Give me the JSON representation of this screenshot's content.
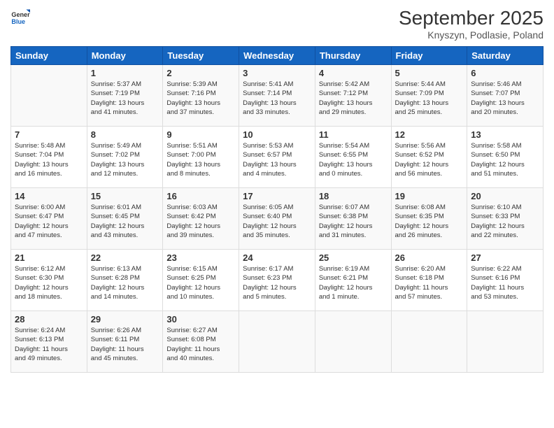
{
  "header": {
    "logo_line1": "General",
    "logo_line2": "Blue",
    "month_year": "September 2025",
    "location": "Knyszyn, Podlasie, Poland"
  },
  "weekdays": [
    "Sunday",
    "Monday",
    "Tuesday",
    "Wednesday",
    "Thursday",
    "Friday",
    "Saturday"
  ],
  "weeks": [
    [
      {
        "day": "",
        "info": ""
      },
      {
        "day": "1",
        "info": "Sunrise: 5:37 AM\nSunset: 7:19 PM\nDaylight: 13 hours\nand 41 minutes."
      },
      {
        "day": "2",
        "info": "Sunrise: 5:39 AM\nSunset: 7:16 PM\nDaylight: 13 hours\nand 37 minutes."
      },
      {
        "day": "3",
        "info": "Sunrise: 5:41 AM\nSunset: 7:14 PM\nDaylight: 13 hours\nand 33 minutes."
      },
      {
        "day": "4",
        "info": "Sunrise: 5:42 AM\nSunset: 7:12 PM\nDaylight: 13 hours\nand 29 minutes."
      },
      {
        "day": "5",
        "info": "Sunrise: 5:44 AM\nSunset: 7:09 PM\nDaylight: 13 hours\nand 25 minutes."
      },
      {
        "day": "6",
        "info": "Sunrise: 5:46 AM\nSunset: 7:07 PM\nDaylight: 13 hours\nand 20 minutes."
      }
    ],
    [
      {
        "day": "7",
        "info": "Sunrise: 5:48 AM\nSunset: 7:04 PM\nDaylight: 13 hours\nand 16 minutes."
      },
      {
        "day": "8",
        "info": "Sunrise: 5:49 AM\nSunset: 7:02 PM\nDaylight: 13 hours\nand 12 minutes."
      },
      {
        "day": "9",
        "info": "Sunrise: 5:51 AM\nSunset: 7:00 PM\nDaylight: 13 hours\nand 8 minutes."
      },
      {
        "day": "10",
        "info": "Sunrise: 5:53 AM\nSunset: 6:57 PM\nDaylight: 13 hours\nand 4 minutes."
      },
      {
        "day": "11",
        "info": "Sunrise: 5:54 AM\nSunset: 6:55 PM\nDaylight: 13 hours\nand 0 minutes."
      },
      {
        "day": "12",
        "info": "Sunrise: 5:56 AM\nSunset: 6:52 PM\nDaylight: 12 hours\nand 56 minutes."
      },
      {
        "day": "13",
        "info": "Sunrise: 5:58 AM\nSunset: 6:50 PM\nDaylight: 12 hours\nand 51 minutes."
      }
    ],
    [
      {
        "day": "14",
        "info": "Sunrise: 6:00 AM\nSunset: 6:47 PM\nDaylight: 12 hours\nand 47 minutes."
      },
      {
        "day": "15",
        "info": "Sunrise: 6:01 AM\nSunset: 6:45 PM\nDaylight: 12 hours\nand 43 minutes."
      },
      {
        "day": "16",
        "info": "Sunrise: 6:03 AM\nSunset: 6:42 PM\nDaylight: 12 hours\nand 39 minutes."
      },
      {
        "day": "17",
        "info": "Sunrise: 6:05 AM\nSunset: 6:40 PM\nDaylight: 12 hours\nand 35 minutes."
      },
      {
        "day": "18",
        "info": "Sunrise: 6:07 AM\nSunset: 6:38 PM\nDaylight: 12 hours\nand 31 minutes."
      },
      {
        "day": "19",
        "info": "Sunrise: 6:08 AM\nSunset: 6:35 PM\nDaylight: 12 hours\nand 26 minutes."
      },
      {
        "day": "20",
        "info": "Sunrise: 6:10 AM\nSunset: 6:33 PM\nDaylight: 12 hours\nand 22 minutes."
      }
    ],
    [
      {
        "day": "21",
        "info": "Sunrise: 6:12 AM\nSunset: 6:30 PM\nDaylight: 12 hours\nand 18 minutes."
      },
      {
        "day": "22",
        "info": "Sunrise: 6:13 AM\nSunset: 6:28 PM\nDaylight: 12 hours\nand 14 minutes."
      },
      {
        "day": "23",
        "info": "Sunrise: 6:15 AM\nSunset: 6:25 PM\nDaylight: 12 hours\nand 10 minutes."
      },
      {
        "day": "24",
        "info": "Sunrise: 6:17 AM\nSunset: 6:23 PM\nDaylight: 12 hours\nand 5 minutes."
      },
      {
        "day": "25",
        "info": "Sunrise: 6:19 AM\nSunset: 6:21 PM\nDaylight: 12 hours\nand 1 minute."
      },
      {
        "day": "26",
        "info": "Sunrise: 6:20 AM\nSunset: 6:18 PM\nDaylight: 11 hours\nand 57 minutes."
      },
      {
        "day": "27",
        "info": "Sunrise: 6:22 AM\nSunset: 6:16 PM\nDaylight: 11 hours\nand 53 minutes."
      }
    ],
    [
      {
        "day": "28",
        "info": "Sunrise: 6:24 AM\nSunset: 6:13 PM\nDaylight: 11 hours\nand 49 minutes."
      },
      {
        "day": "29",
        "info": "Sunrise: 6:26 AM\nSunset: 6:11 PM\nDaylight: 11 hours\nand 45 minutes."
      },
      {
        "day": "30",
        "info": "Sunrise: 6:27 AM\nSunset: 6:08 PM\nDaylight: 11 hours\nand 40 minutes."
      },
      {
        "day": "",
        "info": ""
      },
      {
        "day": "",
        "info": ""
      },
      {
        "day": "",
        "info": ""
      },
      {
        "day": "",
        "info": ""
      }
    ]
  ]
}
